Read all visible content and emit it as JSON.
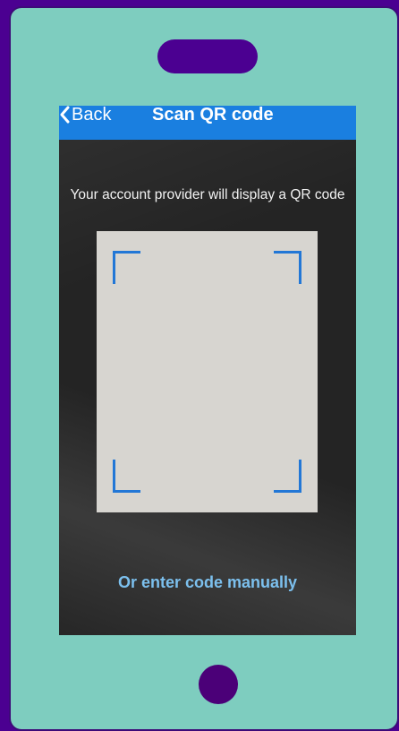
{
  "nav": {
    "back_label": "Back",
    "title": "Scan QR code"
  },
  "main": {
    "instruction": "Your account provider will display a QR code",
    "manual_link": "Or enter code manually"
  },
  "colors": {
    "device_background": "#4b0091",
    "device_body": "#7ecdbf",
    "nav_bar": "#1a7fe0",
    "scan_corners": "#2277d6",
    "link": "#7cc0ee"
  },
  "icons": {
    "back": "chevron-left-icon"
  }
}
